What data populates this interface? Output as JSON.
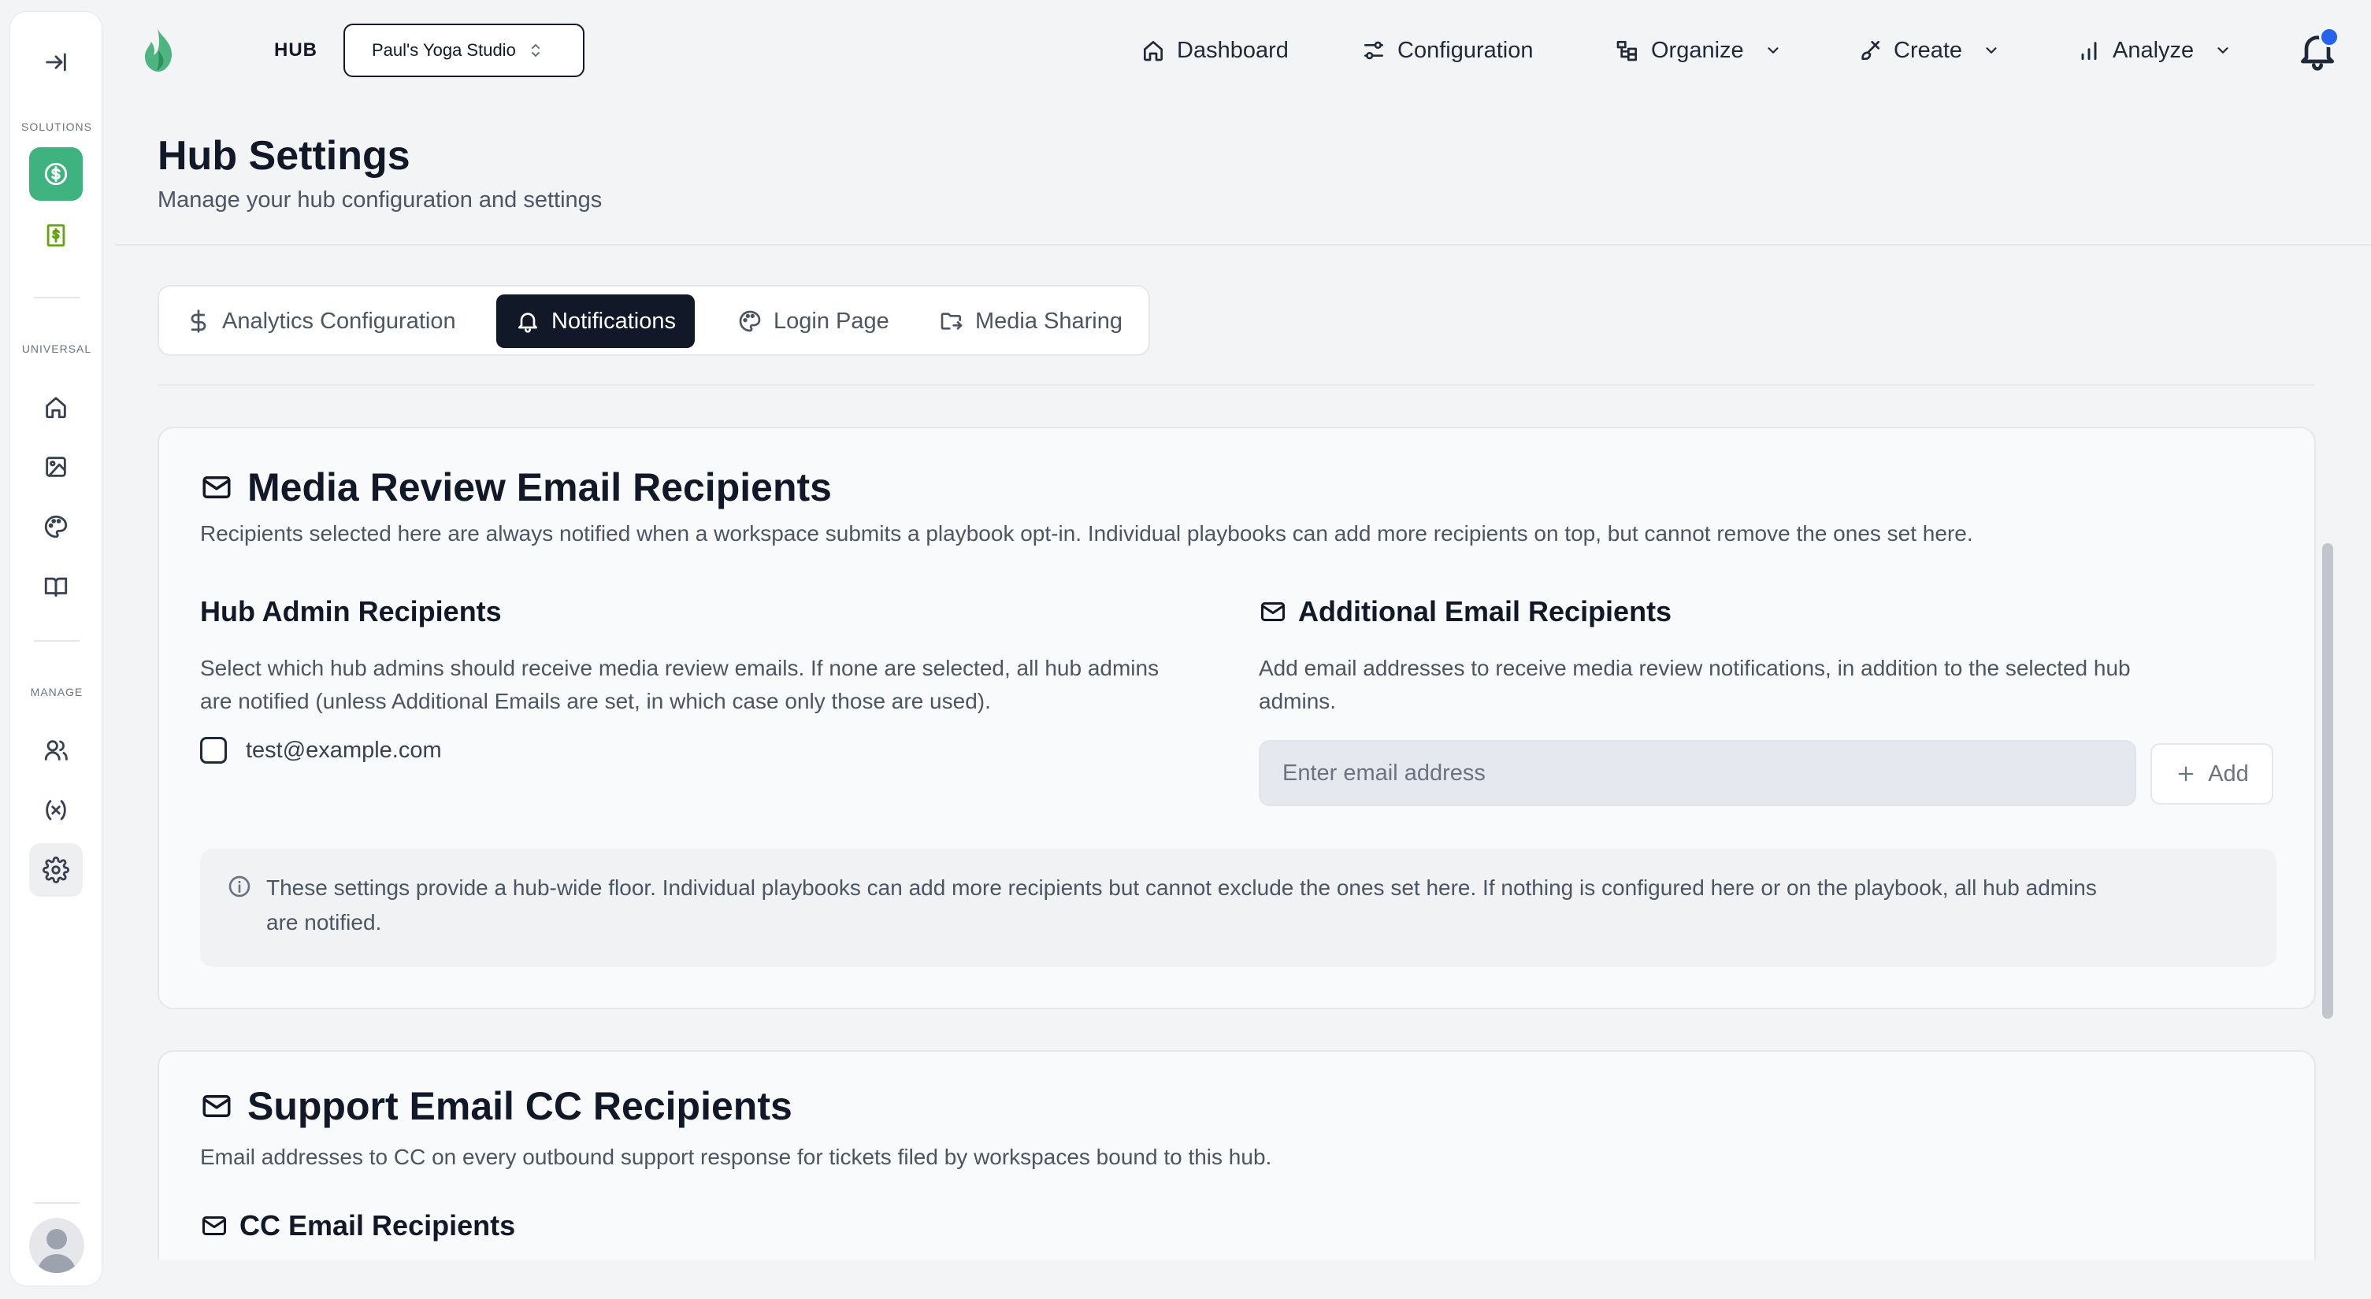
{
  "app": {
    "hub_label": "HUB",
    "workspace": "Paul's Yoga Studio"
  },
  "rail": {
    "sections": {
      "solutions": "SOLUTIONS",
      "universal": "UNIVERSAL",
      "manage": "MANAGE"
    }
  },
  "nav": [
    {
      "label": "Dashboard",
      "icon": "home-icon",
      "has_menu": false
    },
    {
      "label": "Configuration",
      "icon": "sliders-icon",
      "has_menu": false
    },
    {
      "label": "Organize",
      "icon": "tree-icon",
      "has_menu": true
    },
    {
      "label": "Create",
      "icon": "brush-icon",
      "has_menu": true
    },
    {
      "label": "Analyze",
      "icon": "bar-chart-icon",
      "has_menu": true
    }
  ],
  "header": {
    "title": "Hub Settings",
    "subtitle": "Manage your hub configuration and settings"
  },
  "tabs": [
    {
      "label": "Analytics Configuration",
      "icon": "dollar-icon",
      "active": false
    },
    {
      "label": "Notifications",
      "icon": "bell-icon",
      "active": true
    },
    {
      "label": "Login Page",
      "icon": "palette-icon",
      "active": false
    },
    {
      "label": "Media Sharing",
      "icon": "folder-share-icon",
      "active": false
    }
  ],
  "media_review": {
    "title": "Media Review Email Recipients",
    "description": "Recipients selected here are always notified when a workspace submits a playbook opt-in. Individual playbooks can add more recipients on top, but cannot remove the ones set here.",
    "admins": {
      "title": "Hub Admin Recipients",
      "help_line1": "Select which hub admins should receive media review emails. If none are selected, all hub admins",
      "help_line2": "are notified (unless Additional Emails are set, in which case only those are used).",
      "options": [
        {
          "email": "test@example.com",
          "checked": false
        }
      ]
    },
    "additional": {
      "title": "Additional Email Recipients",
      "help_line1": "Add email addresses to receive media review notifications, in addition to the selected hub",
      "help_line2": "admins.",
      "input_value": "",
      "input_placeholder": "Enter email address",
      "add_label": "Add"
    },
    "info_line1": "These settings provide a hub-wide floor. Individual playbooks can add more recipients but cannot exclude the ones set here. If nothing is configured here or on the playbook, all hub admins",
    "info_line2": "are notified."
  },
  "support_cc": {
    "title": "Support Email CC Recipients",
    "description": "Email addresses to CC on every outbound support response for tickets filed by workspaces bound to this hub.",
    "cc_title": "CC Email Recipients"
  },
  "colors": {
    "accent_green": "#3fb37f",
    "dark": "#111827",
    "notification_dot": "#2563eb"
  }
}
